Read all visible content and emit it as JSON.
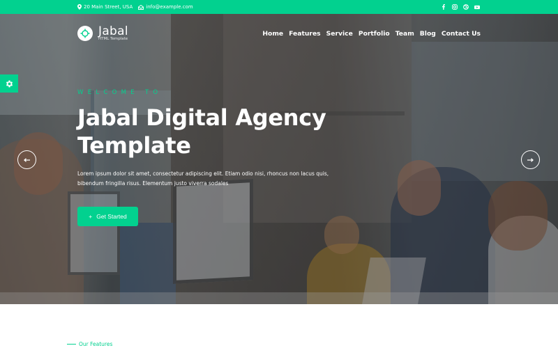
{
  "topbar": {
    "address": "20 Main Street, USA",
    "email": "info@example.com",
    "socials": [
      "facebook",
      "instagram",
      "dribbble",
      "youtube"
    ]
  },
  "brand": {
    "name": "Jabal",
    "tagline": "HTML Template",
    "accent_color": "#02d18f"
  },
  "nav": {
    "items": [
      "Home",
      "Features",
      "Service",
      "Portfolio",
      "Team",
      "Blog",
      "Contact Us"
    ]
  },
  "hero": {
    "eyebrow": "WELCOME TO",
    "title_line1": "Jabal Digital Agency",
    "title_line2": "Template",
    "description": "Lorem ipsum dolor sit amet, consectetur adipiscing elit. Etiam odio nisi, rhoncus non lacus quis, bibendum fringilla risus. Elementum justo viverra sodales",
    "cta_label": "Get Started",
    "cta_icon": "+"
  },
  "slider": {
    "prev_icon": "arrow-left",
    "next_icon": "arrow-right"
  },
  "features_section": {
    "label": "Our Features"
  }
}
